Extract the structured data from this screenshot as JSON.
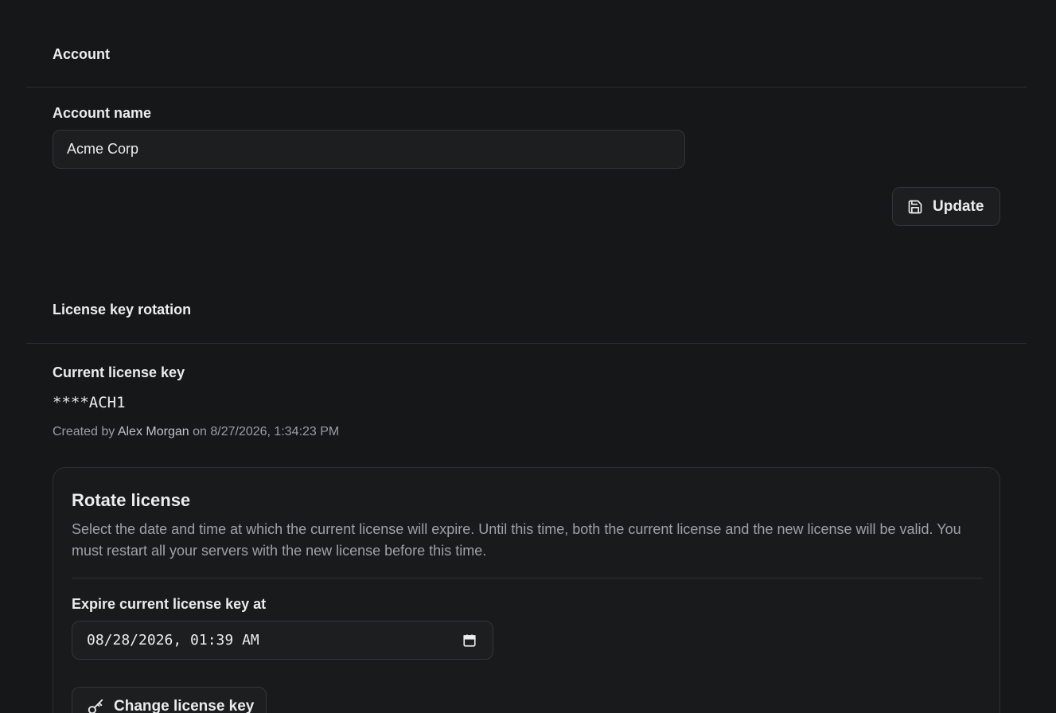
{
  "account": {
    "section_title": "Account",
    "name_label": "Account name",
    "name_value": "Acme Corp",
    "update_label": "Update"
  },
  "license": {
    "section_title": "License key rotation",
    "current_label": "Current license key",
    "current_key": "****ACH1",
    "created_prefix": "Created by",
    "created_by": "Alex Morgan",
    "created_on_word": "on",
    "created_at": "8/27/2026, 1:34:23 PM"
  },
  "rotate": {
    "title": "Rotate license",
    "description": "Select the date and time at which the current license will expire. Until this time, both the current license and the new license will be valid. You must restart all your servers with the new license before this time.",
    "expire_label": "Expire current license key at",
    "expire_value": "08/28/2026, 01:39 AM",
    "change_label": "Change license key"
  },
  "icons": {
    "update": "save-icon",
    "calendar": "calendar-icon",
    "change": "key-icon"
  }
}
